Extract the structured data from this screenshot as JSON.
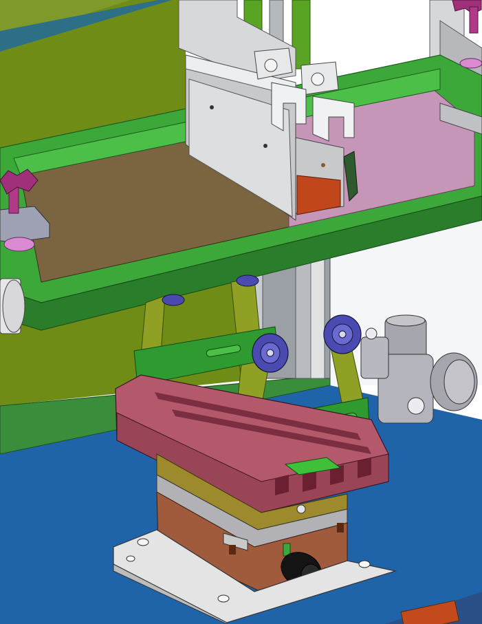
{
  "scene": {
    "description_visible_text": "",
    "colors": {
      "background_top": "#ffffff",
      "wall_olive": "#6f8d16",
      "frame_green": "#3ca83a",
      "frame_green_dark": "#2a7d2a",
      "screen_brown": "#7a6540",
      "screen_pink": "#c696b8",
      "base_blue": "#1f64a8",
      "head_silver": "#d6d8da",
      "rod_green": "#5aa424",
      "arm_olive": "#8fa024",
      "roller_purple": "#4a4ab0",
      "table_rose": "#b4586c",
      "slide_bronze": "#9c8a2c",
      "block_copper": "#a05a3c",
      "plate_grey": "#e4e4e4",
      "knob_magenta": "#a0307a",
      "regulator_grey": "#a6a6ae"
    },
    "icons": [
      "pad-printer-head",
      "ink-tray-frame",
      "roller-arm",
      "xy-adjust-table",
      "air-regulator",
      "clamp-knob"
    ]
  }
}
